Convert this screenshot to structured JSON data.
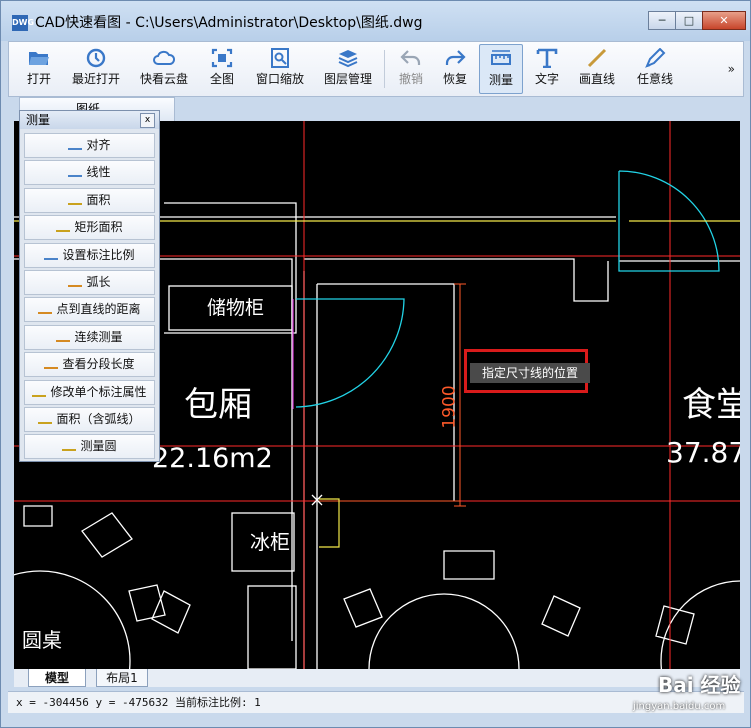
{
  "window": {
    "app_icon": "DWG",
    "title": "CAD快速看图 - C:\\Users\\Administrator\\Desktop\\图纸.dwg",
    "controls": [
      "─",
      "□",
      "✕"
    ]
  },
  "toolbar": {
    "items": [
      {
        "label": "打开",
        "icon": "folder-open-icon",
        "color": "#3a78c8"
      },
      {
        "label": "最近打开",
        "icon": "clock-icon",
        "color": "#3a78c8"
      },
      {
        "label": "快看云盘",
        "icon": "cloud-icon",
        "color": "#3a78c8"
      },
      {
        "label": "全图",
        "icon": "fit-screen-icon",
        "color": "#3a78c8"
      },
      {
        "label": "窗口缩放",
        "icon": "zoom-window-icon",
        "color": "#3a78c8"
      },
      {
        "label": "图层管理",
        "icon": "layers-icon",
        "color": "#3a78c8"
      },
      {
        "label": "撤销",
        "icon": "undo-icon",
        "color": "#9aa6b5"
      },
      {
        "label": "恢复",
        "icon": "redo-icon",
        "color": "#3a78c8"
      },
      {
        "label": "测量",
        "icon": "ruler-icon",
        "color": "#3a78c8"
      },
      {
        "label": "文字",
        "icon": "text-icon",
        "color": "#3a78c8"
      },
      {
        "label": "画直线",
        "icon": "line-icon",
        "color": "#c89a3a"
      },
      {
        "label": "任意线",
        "icon": "pen-icon",
        "color": "#3a78c8"
      }
    ],
    "more": "»"
  },
  "doc_tab": {
    "label": "图纸"
  },
  "measure_panel": {
    "title": "测量",
    "close": "x",
    "items": [
      {
        "label": "对齐",
        "icon": "align-measure-icon"
      },
      {
        "label": "线性",
        "icon": "linear-measure-icon"
      },
      {
        "label": "面积",
        "icon": "area-icon"
      },
      {
        "label": "矩形面积",
        "icon": "rect-area-icon"
      },
      {
        "label": "设置标注比例",
        "icon": "scale-icon"
      },
      {
        "label": "弧长",
        "icon": "arc-length-icon"
      },
      {
        "label": "点到直线的距离",
        "icon": "point-line-icon"
      },
      {
        "label": "连续测量",
        "icon": "continuous-measure-icon"
      },
      {
        "label": "查看分段长度",
        "icon": "segment-length-icon"
      },
      {
        "label": "修改单个标注属性",
        "icon": "edit-dimension-icon"
      },
      {
        "label": "面积（含弧线）",
        "icon": "arc-area-icon"
      },
      {
        "label": "测量圆",
        "icon": "circle-measure-icon"
      }
    ]
  },
  "drawing": {
    "labels": {
      "storage": "储物柜",
      "room": "包厢",
      "room_area": "22.16m2",
      "fridge": "冰柜",
      "round_table": "圆桌",
      "dining": "食堂",
      "dining_area": "37.87",
      "dimension": "1900"
    },
    "tooltip": "指定尺寸线的位置",
    "colors": {
      "wall": "#ffffff",
      "door": "#22d3e6",
      "dimension": "#ff4a2a",
      "axis": "#ff2a2a",
      "yellow": "#f2e84a",
      "magenta": "#d23ad2"
    }
  },
  "bottom_tabs": {
    "model": "模型",
    "layout": "布局1"
  },
  "status": {
    "text": "x = -304456 y = -475632 当前标注比例: 1"
  },
  "watermark": {
    "brand": "Bai 经验",
    "url": "jingyan.baidu.com"
  }
}
